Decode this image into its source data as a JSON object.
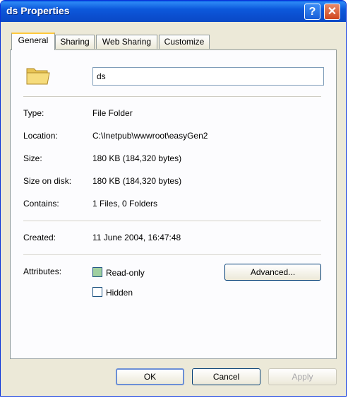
{
  "window": {
    "title": "ds Properties"
  },
  "titlebar": {
    "help_glyph": "?",
    "close_glyph": "✕"
  },
  "tabs": [
    {
      "label": "General",
      "active": true
    },
    {
      "label": "Sharing",
      "active": false
    },
    {
      "label": "Web Sharing",
      "active": false
    },
    {
      "label": "Customize",
      "active": false
    }
  ],
  "general": {
    "name_value": "ds",
    "icon": "folder-icon",
    "type_label": "Type:",
    "type_value": "File Folder",
    "location_label": "Location:",
    "location_value": "C:\\Inetpub\\wwwroot\\easyGen2",
    "size_label": "Size:",
    "size_value": "180 KB (184,320 bytes)",
    "size_on_disk_label": "Size on disk:",
    "size_on_disk_value": "180 KB (184,320 bytes)",
    "contains_label": "Contains:",
    "contains_value": "1 Files, 0 Folders",
    "created_label": "Created:",
    "created_value": "11 June 2004, 16:47:48",
    "attributes_label": "Attributes:",
    "readonly_label": "Read-only",
    "hidden_label": "Hidden",
    "advanced_label": "Advanced..."
  },
  "footer": {
    "ok_label": "OK",
    "cancel_label": "Cancel",
    "apply_label": "Apply"
  },
  "colors": {
    "titlebar": "#0a5fe6",
    "dialog_bg": "#ece9d8",
    "tab_highlight": "#ffc83c"
  }
}
